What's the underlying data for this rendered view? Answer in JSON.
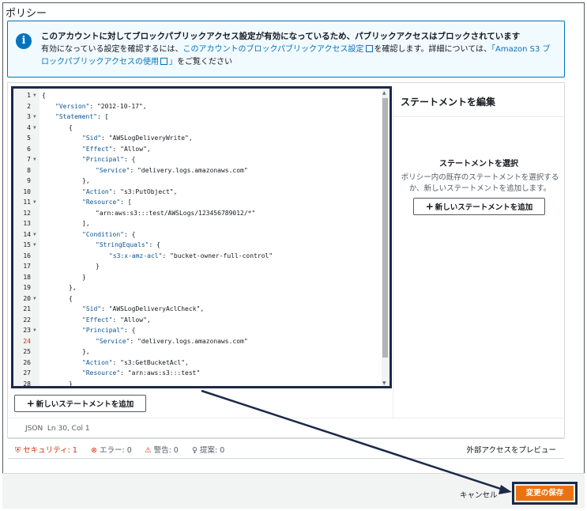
{
  "policy_title": "ポリシー",
  "info": {
    "icon": "info-icon",
    "title": "このアカウントに対してブロックパブリックアクセス設定が有効になっているため、パブリックアクセスはブロックされています",
    "body_prefix": "有効になっている設定を確認するには、",
    "link1": "このアカウントのブロックパブリックアクセス設定",
    "body_middle": "を確認します。詳細については、",
    "link2_open": "「Amazon S3 ブロックパブリックアクセスの使用",
    "link2_close": "」",
    "body_suffix": "をご覧ください"
  },
  "editor": {
    "lines": [
      {
        "n": "1",
        "fold": true,
        "indent": 0,
        "text": "{"
      },
      {
        "n": "2",
        "fold": false,
        "indent": 1,
        "key": "\"Version\"",
        "rest": ": \"2012-10-17\","
      },
      {
        "n": "3",
        "fold": true,
        "indent": 1,
        "key": "\"Statement\"",
        "rest": ": ["
      },
      {
        "n": "4",
        "fold": true,
        "indent": 2,
        "text": "{"
      },
      {
        "n": "5",
        "fold": false,
        "indent": 3,
        "key": "\"Sid\"",
        "rest": ": \"AWSLogDeliveryWrite\","
      },
      {
        "n": "6",
        "fold": false,
        "indent": 3,
        "key": "\"Effect\"",
        "rest": ": \"Allow\","
      },
      {
        "n": "7",
        "fold": true,
        "indent": 3,
        "key": "\"Principal\"",
        "rest": ": {"
      },
      {
        "n": "8",
        "fold": false,
        "indent": 4,
        "key": "\"Service\"",
        "rest": ": \"delivery.logs.amazonaws.com\""
      },
      {
        "n": "9",
        "fold": false,
        "indent": 3,
        "text": "},"
      },
      {
        "n": "10",
        "fold": false,
        "indent": 3,
        "key": "\"Action\"",
        "rest": ": \"s3:PutObject\","
      },
      {
        "n": "11",
        "fold": true,
        "indent": 3,
        "key": "\"Resource\"",
        "rest": ": ["
      },
      {
        "n": "12",
        "fold": false,
        "indent": 4,
        "text": "\"arn:aws:s3:::test/AWSLogs/123456789012/*\""
      },
      {
        "n": "13",
        "fold": false,
        "indent": 3,
        "text": "],"
      },
      {
        "n": "14",
        "fold": true,
        "indent": 3,
        "key": "\"Condition\"",
        "rest": ": {"
      },
      {
        "n": "15",
        "fold": true,
        "indent": 4,
        "key": "\"StringEquals\"",
        "rest": ": {"
      },
      {
        "n": "16",
        "fold": false,
        "indent": 5,
        "key": "\"s3:x-amz-acl\"",
        "rest": ": \"bucket-owner-full-control\""
      },
      {
        "n": "17",
        "fold": false,
        "indent": 4,
        "text": "}"
      },
      {
        "n": "18",
        "fold": false,
        "indent": 3,
        "text": "}"
      },
      {
        "n": "19",
        "fold": false,
        "indent": 2,
        "text": "},"
      },
      {
        "n": "20",
        "fold": true,
        "indent": 2,
        "text": "{"
      },
      {
        "n": "21",
        "fold": false,
        "indent": 3,
        "key": "\"Sid\"",
        "rest": ": \"AWSLogDeliveryAclCheck\","
      },
      {
        "n": "22",
        "fold": false,
        "indent": 3,
        "key": "\"Effect\"",
        "rest": ": \"Allow\","
      },
      {
        "n": "23",
        "fold": true,
        "indent": 3,
        "key": "\"Principal\"",
        "rest": ": {"
      },
      {
        "n": "24",
        "fold": false,
        "indent": 4,
        "key": "\"Service\"",
        "rest": ": \"delivery.logs.amazonaws.com\"",
        "warn": true
      },
      {
        "n": "25",
        "fold": false,
        "indent": 3,
        "text": "},"
      },
      {
        "n": "26",
        "fold": false,
        "indent": 3,
        "key": "\"Action\"",
        "rest": ": \"s3:GetBucketAcl\","
      },
      {
        "n": "27",
        "fold": false,
        "indent": 3,
        "key": "\"Resource\"",
        "rest": ": \"arn:aws:s3:::test\""
      },
      {
        "n": "28",
        "fold": false,
        "indent": 2,
        "text": "}"
      }
    ]
  },
  "add_statement_label": "新しいステートメントを追加",
  "side_panel": {
    "title": "ステートメントを編集",
    "select_title": "ステートメントを選択",
    "select_desc": "ポリシー内の既存のステートメントを選択するか、新しいステートメントを追加します。",
    "add_label": "新しいステートメントを追加"
  },
  "status": {
    "mode": "JSON",
    "position": "Ln 30, Col 1"
  },
  "lint": {
    "security": "セキュリティ: 1",
    "errors": "エラー: 0",
    "warnings": "警告: 0",
    "suggestions": "提案: 0",
    "preview": "外部アクセスをプレビュー"
  },
  "footer": {
    "cancel": "キャンセル",
    "save": "変更の保存"
  },
  "colors": {
    "accent": "#0073bb",
    "primary_button": "#ec7211",
    "annotation": "#1b2a49",
    "danger": "#d13212"
  }
}
